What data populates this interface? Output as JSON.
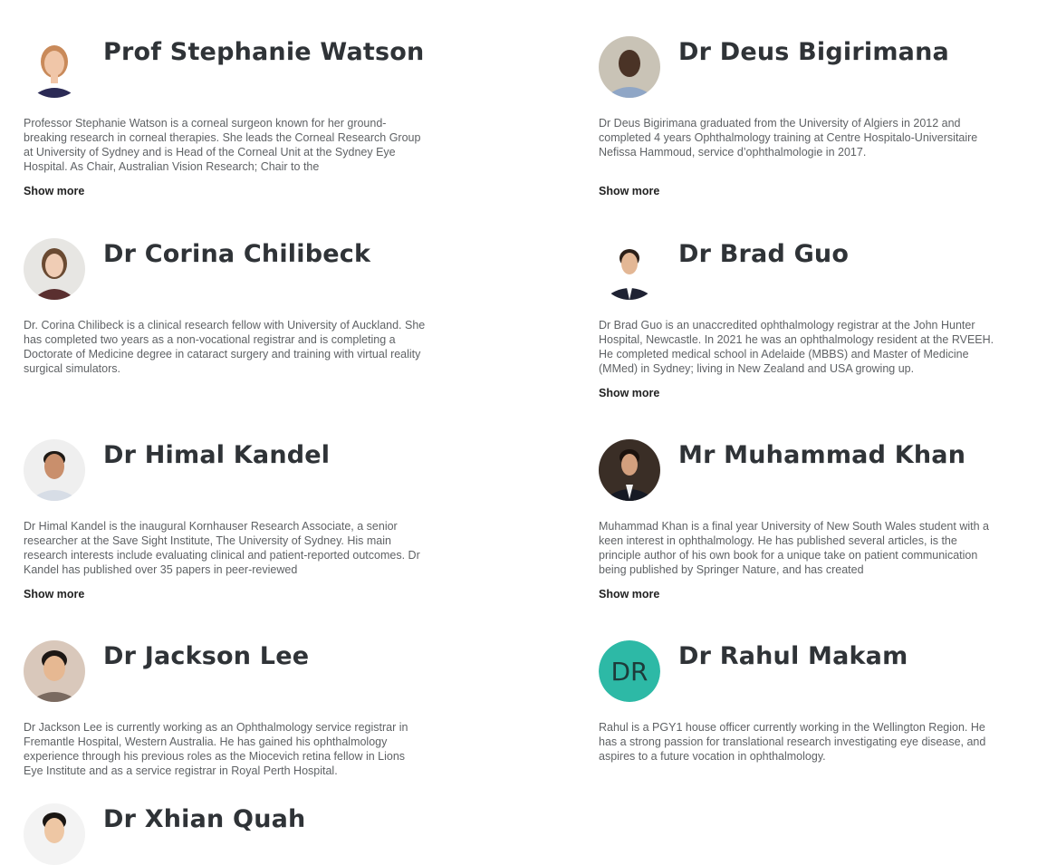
{
  "people": [
    {
      "name": "Prof Stephanie Watson",
      "bio": "Professor Stephanie Watson is a corneal surgeon known for her ground-breaking research in corneal therapies. She leads the Corneal Research Group at University of Sydney and is Head of the Corneal Unit at the Sydney Eye Hospital. As Chair, Australian Vision Research; Chair to the",
      "show_more": "Show more"
    },
    {
      "name": "Dr Deus Bigirimana",
      "bio": "Dr Deus Bigirimana graduated from the University of Algiers in 2012 and completed 4 years Ophthalmology training at Centre Hospitalo-Universitaire Nefissa Hammoud, service d’ophthalmologie in 2017.",
      "show_more": "Show more"
    },
    {
      "name": "Dr Corina Chilibeck",
      "bio": "Dr. Corina Chilibeck is a clinical research fellow with University of Auckland. She has completed two years as a non-vocational registrar and is completing a Doctorate of Medicine degree in cataract surgery and training with virtual reality surgical simulators."
    },
    {
      "name": "Dr Brad Guo",
      "bio": "Dr Brad Guo is an unaccredited ophthalmology registrar at the John Hunter Hospital, Newcastle. In 2021 he was an ophthalmology resident at the RVEEH. He completed medical school in Adelaide (MBBS) and Master of Medicine (MMed) in Sydney; living in New Zealand and USA growing up.",
      "show_more": "Show more"
    },
    {
      "name": "Dr Himal Kandel",
      "bio": "Dr Himal Kandel is the inaugural Kornhauser Research Associate, a senior researcher at the Save Sight Institute, The University of Sydney. His main research interests include evaluating clinical and patient-reported outcomes. Dr Kandel has published over 35 papers in peer-reviewed",
      "show_more": "Show more"
    },
    {
      "name": "Mr Muhammad Khan",
      "bio": "Muhammad Khan is a final year University of New South Wales student with a keen interest in ophthalmology. He has published several articles, is the principle author of his own book for a unique take on patient communication being published by Springer Nature, and has created",
      "show_more": "Show more"
    },
    {
      "name": "Dr Jackson Lee",
      "bio": "Dr Jackson Lee is currently working as an Ophthalmology service registrar in Fremantle Hospital, Western Australia. He has gained his ophthalmology experience through his previous roles as the Miocevich retina fellow in Lions Eye Institute and as a service registrar in Royal Perth Hospital."
    },
    {
      "name": "Dr Rahul Makam",
      "initials": "DR",
      "bio": "Rahul is a PGY1 house officer currently working in the Wellington Region. He has a strong passion for translational research investigating eye disease, and aspires to a future vocation in ophthalmology."
    },
    {
      "name": "Dr Xhian Quah"
    }
  ],
  "colors": {
    "name": "#2f3337",
    "bio": "#5f6265",
    "initials_bg": "#2db9a6"
  }
}
